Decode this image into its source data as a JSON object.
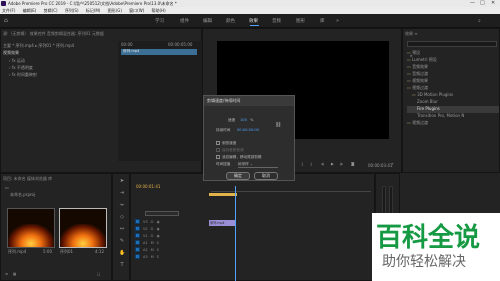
{
  "window": {
    "title": "Adobe Premiere Pro CC 2019 - C:\\用户\\250512\\文档\\Adobe\\Premiere Pro\\13.0\\未命名 *",
    "minimize": "—",
    "maximize": "□",
    "close": "✕"
  },
  "menu": [
    "文件(F)",
    "编辑(E)",
    "剪辑(C)",
    "序列(S)",
    "标记(M)",
    "图形(G)",
    "窗口(W)",
    "帮助(H)"
  ],
  "workspaces": [
    "学习",
    "组件",
    "编辑",
    "颜色",
    "效果",
    "音频",
    "图形",
    "库"
  ],
  "workspace_active": "效果",
  "source_panel": {
    "tabs": "源:（无剪辑）  效果控件  音频剪辑混合器: 序列01  元数据",
    "seq_label": "主要 * 序列.mp4 ▸ 序列01 * 序列.mp4",
    "section": "视频效果",
    "items": [
      "运动",
      "不透明度",
      "时间重映射"
    ],
    "timecode": "00:00",
    "timecode_right": "00:00:05:00",
    "clip_label": "序列.mp4"
  },
  "program": {
    "timecode": "00:00:01:41",
    "end_timecode": "00:00:03:41"
  },
  "effects": {
    "tabs": "效果 ≡",
    "items": [
      "预设",
      "Lumetri 预设",
      "音频效果",
      "音频过渡",
      "视频效果",
      "视频过渡",
      "3D Motion Plugins",
      "Zoom Blur",
      "Fire Plugins",
      "Transition Pro, Motion N",
      "视频过渡"
    ]
  },
  "project": {
    "tabs": "项目: 未命名  媒体浏览器  库",
    "folder": "未命名.prproj",
    "clips": [
      {
        "name": "序列.mp4",
        "duration": "5:00"
      },
      {
        "name": "序列01",
        "duration": "4:12"
      }
    ]
  },
  "timeline": {
    "timecode": "00:00:01:41",
    "tracks": [
      "V3",
      "V2",
      "V1",
      "A1",
      "A2",
      "A3"
    ],
    "clip": "序列.mp4"
  },
  "dialog": {
    "title": "剪辑速度/持续时间",
    "speed_label": "速度",
    "speed_value": "100",
    "speed_unit": "%",
    "duration_label": "持续时间",
    "duration_value": "00:00:05:00",
    "chain": "⛓",
    "reverse": "倒放速度",
    "audio_pitch": "保持音频音调",
    "ripple": "波纹编辑，移动尾部剪辑",
    "interp_label": "时间插值",
    "interp_value": "帧采样",
    "ok": "确定",
    "cancel": "取消"
  },
  "watermark": {
    "brand": "百科全说",
    "sub": "助你轻松解决"
  }
}
